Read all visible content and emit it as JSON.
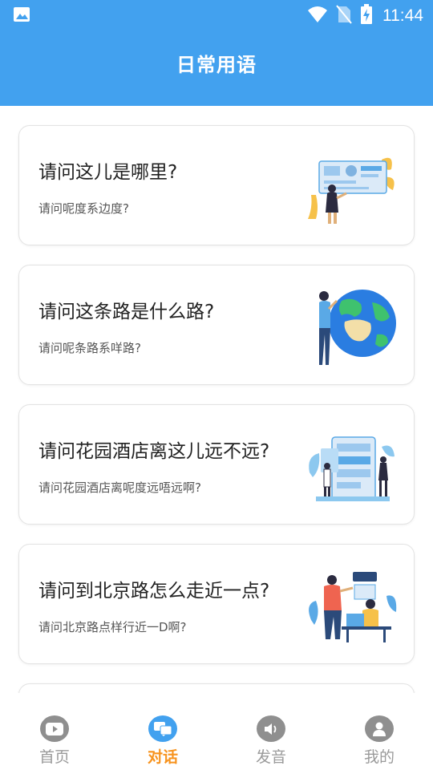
{
  "status_bar": {
    "time": "11:44",
    "icons": [
      "image-icon",
      "wifi-icon",
      "no-sim-icon",
      "battery-charging-icon"
    ]
  },
  "header": {
    "title": "日常用语"
  },
  "phrases": [
    {
      "title": "请问这儿是哪里?",
      "subtitle": "请问呢度系边度?",
      "illustration": "info-board-illustration"
    },
    {
      "title": "请问这条路是什么路?",
      "subtitle": "请问呢条路系咩路?",
      "illustration": "globe-illustration"
    },
    {
      "title": "请问花园酒店离这儿远不远?",
      "subtitle": "请问花园酒店离呢度远唔远啊?",
      "illustration": "app-screens-illustration"
    },
    {
      "title": "请问到北京路怎么走近一点?",
      "subtitle": "请问北京路点样行近一D啊?",
      "illustration": "office-desk-illustration"
    }
  ],
  "tabs": [
    {
      "label": "首页",
      "icon": "play-icon",
      "active": false
    },
    {
      "label": "对话",
      "icon": "chat-icon",
      "active": true
    },
    {
      "label": "发音",
      "icon": "speaker-icon",
      "active": false
    },
    {
      "label": "我的",
      "icon": "user-icon",
      "active": false
    }
  ],
  "colors": {
    "primary": "#42a1ef",
    "active_tab": "#f7931e",
    "inactive_tab": "#9a9a9a"
  }
}
